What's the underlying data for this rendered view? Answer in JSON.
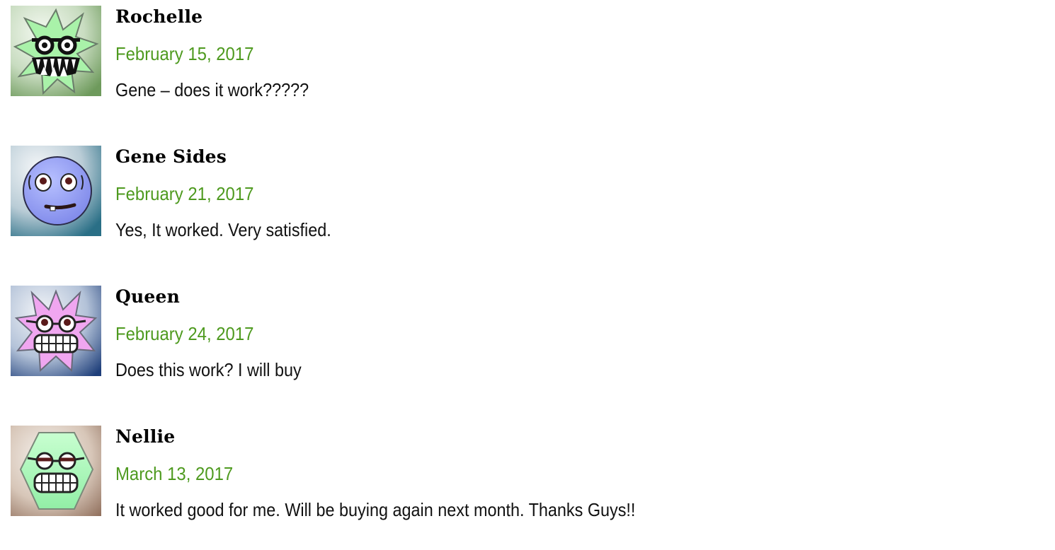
{
  "comments": [
    {
      "author": "Rochelle",
      "date": "February 15, 2017",
      "text": "Gene – does it work?????",
      "avatar_icon": "green-star-monster-avatar-icon",
      "colors": {
        "bg_from": "#f4f9f1",
        "bg_to": "#6e9a5c",
        "face": "#a9f2a9"
      }
    },
    {
      "author": "Gene Sides",
      "date": "February 21, 2017",
      "text": "Yes, It worked. Very satisfied.",
      "avatar_icon": "blue-round-face-avatar-icon",
      "colors": {
        "bg_from": "#f4f6f8",
        "bg_to": "#2a6f86",
        "face": "#8e9af4"
      }
    },
    {
      "author": "Queen",
      "date": "February 24, 2017",
      "text": "Does this work? I will buy",
      "avatar_icon": "pink-star-glasses-avatar-icon",
      "colors": {
        "bg_from": "#f3f5f8",
        "bg_to": "#1f3f7a",
        "face": "#f0a6f0"
      }
    },
    {
      "author": "Nellie",
      "date": "March 13, 2017",
      "text": "It worked good for me. Will be buying again next month. Thanks Guys!!",
      "avatar_icon": "green-hexagon-glasses-avatar-icon",
      "colors": {
        "bg_from": "#f7f3ef",
        "bg_to": "#8c6a57",
        "face": "#aaf6b9"
      }
    }
  ],
  "theme": {
    "date_color": "#4e9a1f",
    "author_color": "#000000",
    "text_color": "#111111"
  }
}
